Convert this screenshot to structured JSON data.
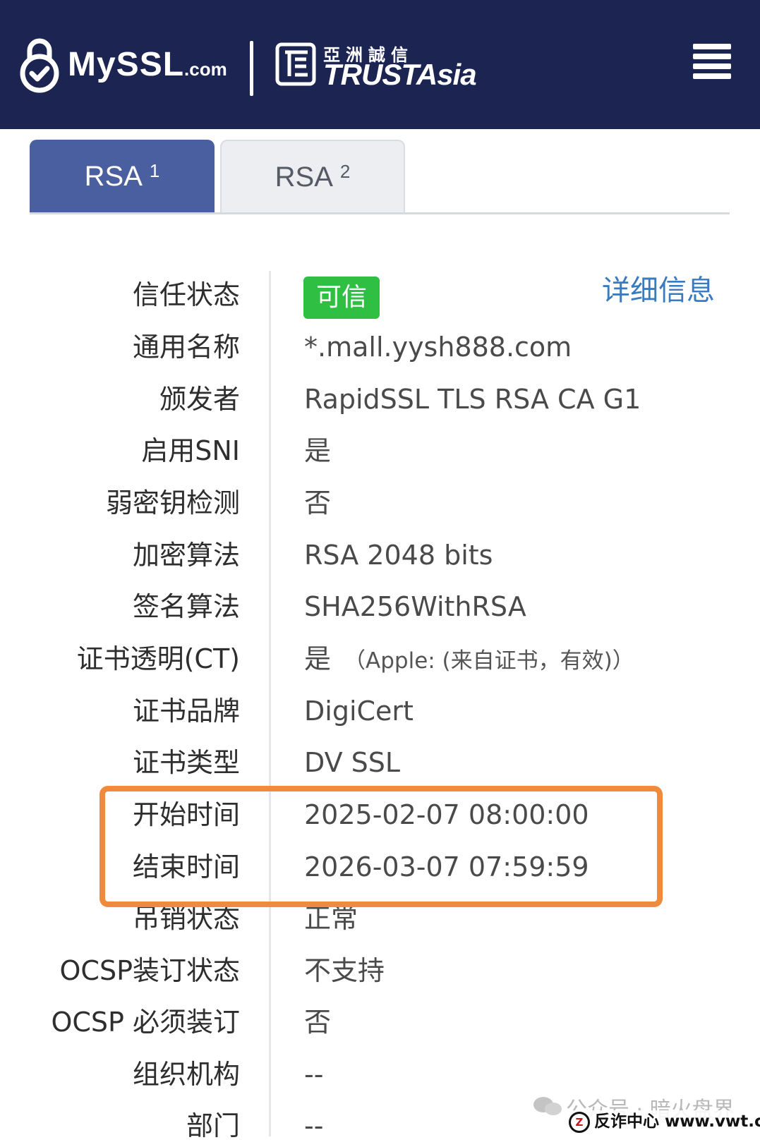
{
  "header": {
    "logo_main": "MySSL",
    "logo_suffix": ".com",
    "partner_cn": "亞洲誠信",
    "partner_en": "TRUSTAsia",
    "menu_icon": "hamburger-menu-icon"
  },
  "tabs": [
    {
      "label": "RSA",
      "index": "1",
      "active": true
    },
    {
      "label": "RSA",
      "index": "2",
      "active": false
    }
  ],
  "trust_badge": "可信",
  "details_link": "详细信息",
  "rows": [
    {
      "label": "信任状态",
      "value": ""
    },
    {
      "label": "通用名称",
      "value": "*.mall.yysh888.com"
    },
    {
      "label": "颁发者",
      "value": "RapidSSL TLS RSA CA G1"
    },
    {
      "label": "启用SNI",
      "value": "是"
    },
    {
      "label": "弱密钥检测",
      "value": "否"
    },
    {
      "label": "加密算法",
      "value": "RSA 2048 bits"
    },
    {
      "label": "签名算法",
      "value": "SHA256WithRSA"
    },
    {
      "label": "证书透明(CT)",
      "value": "是",
      "note": "（Apple: (来自证书，有效)）"
    },
    {
      "label": "证书品牌",
      "value": "DigiCert"
    },
    {
      "label": "证书类型",
      "value": "DV SSL"
    },
    {
      "label": "开始时间",
      "value": "2025-02-07 08:00:00"
    },
    {
      "label": "结束时间",
      "value": "2026-03-07 07:59:59"
    },
    {
      "label": "吊销状态",
      "value": "正常"
    },
    {
      "label": "OCSP装订状态",
      "value": "不支持"
    },
    {
      "label": "OCSP 必须装订",
      "value": "否"
    },
    {
      "label": "组织机构",
      "value": "--"
    },
    {
      "label": "部门",
      "value": "--"
    }
  ],
  "watermark": "公众号 · 暗火盘界",
  "source_line": "反诈中心 www.vwt.cc",
  "colors": {
    "header_bg": "#1c2452",
    "tab_active": "#4a5fa0",
    "trusted_green": "#2fbf43",
    "link_blue": "#3a7bc0",
    "highlight_orange": "#f08a3c"
  }
}
